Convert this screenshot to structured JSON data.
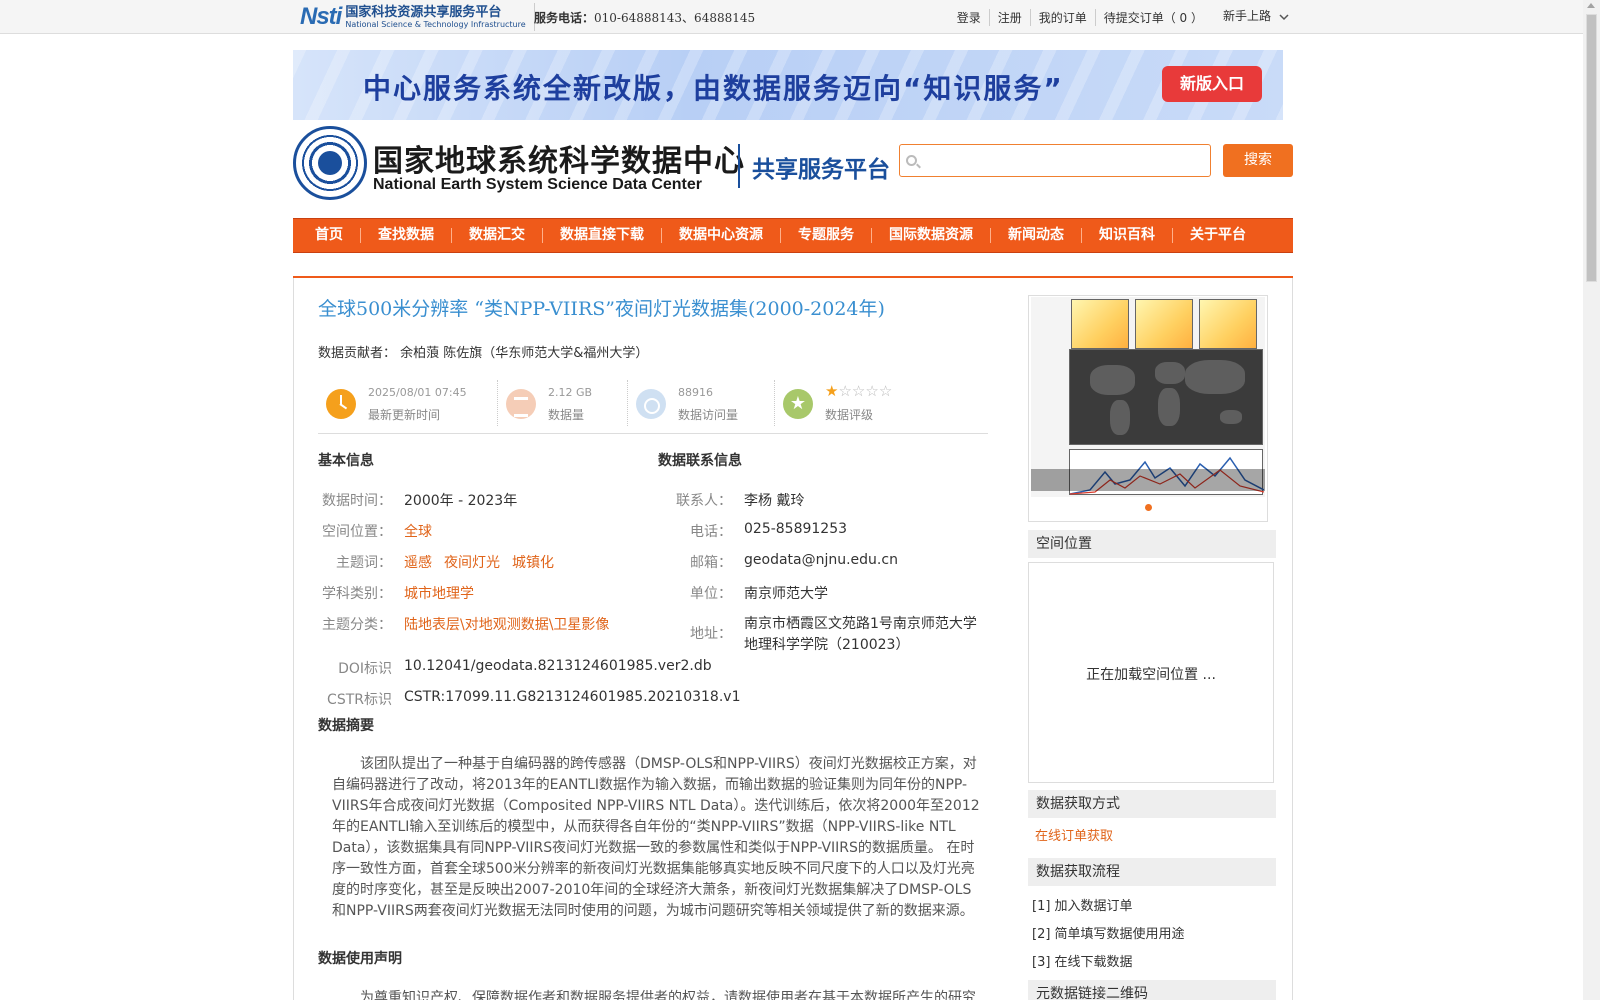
{
  "topbar": {
    "logo_mark": "Nsti",
    "logo_cn": "国家科技资源共享服务平台",
    "logo_en": "National Science & Technology Infrastructure",
    "phone_label": "服务电话：",
    "phone_value": "010-64888143、64888145",
    "links": [
      "登录",
      "注册",
      "我的订单",
      "待提交订单（ 0 ）"
    ],
    "newbie": "新手上路"
  },
  "banner": {
    "text": "中心服务系统全新改版，由数据服务迈向“知识服务”",
    "button": "新版入口"
  },
  "header": {
    "cn_name": "国家地球系统科学数据中心",
    "en_name": "National Earth System Science Data Center",
    "platform": "共享服务平台",
    "search_placeholder": "",
    "search_button": "搜索"
  },
  "nav": [
    "首页",
    "查找数据",
    "数据汇交",
    "数据直接下载",
    "数据中心资源",
    "专题服务",
    "国际数据资源",
    "新闻动态",
    "知识百科",
    "关于平台"
  ],
  "dataset": {
    "title": "全球500米分辨率 “类NPP-VIIRS”夜间灯光数据集(2000-2024年)",
    "contributor_label": "数据贡献者：",
    "contributor": "余柏蒗 陈佐旗（华东师范大学&福州大学）"
  },
  "stats": {
    "update_value": "2025/08/01 07:45",
    "update_label": "最新更新时间",
    "size_value": "2.12 GB",
    "size_label": "数据量",
    "visits_value": "88916",
    "visits_label": "数据访问量",
    "rating_label": "数据评级",
    "rating_stars": 1,
    "rating_max": 5
  },
  "basic": {
    "title": "基本信息",
    "time_label": "数据时间：",
    "time_value": "2000年 - 2023年",
    "space_label": "空间位置：",
    "space_value": "全球",
    "keywords_label": "主题词：",
    "keywords": [
      "遥感",
      "夜间灯光",
      "城镇化"
    ],
    "discipline_label": "学科类别：",
    "discipline_value": "城市地理学",
    "category_label": "主题分类：",
    "category_value": "陆地表层\\对地观测数据\\卫星影像",
    "doi_label": "DOI标识",
    "doi_value": "10.12041/geodata.8213124601985.ver2.db",
    "cstr_label": "CSTR标识",
    "cstr_value": "CSTR:17099.11.G8213124601985.20210318.v1"
  },
  "contact": {
    "title": "数据联系信息",
    "person_label": "联系人：",
    "person_value": "李杨 戴玲",
    "phone_label": "电话：",
    "phone_value": "025-85891253",
    "email_label": "邮箱：",
    "email_value": "geodata@njnu.edu.cn",
    "unit_label": "单位：",
    "unit_value": "南京师范大学",
    "address_label": "地址：",
    "address_line1": "南京市栖霞区文苑路1号南京师范大学",
    "address_line2": "地理科学学院（210023）"
  },
  "abstract": {
    "title": "数据摘要",
    "text": "该团队提出了一种基于自编码器的跨传感器（DMSP-OLS和NPP-VIIRS）夜间灯光数据校正方案，对自编码器进行了改动，将2013年的EANTLI数据作为输入数据，而输出数据的验证集则为同年份的NPP-VIIRS年合成夜间灯光数据（Composited NPP-VIIRS NTL Data）。迭代训练后，依次将2000年至2012年的EANTLI输入至训练后的模型中，从而获得各自年份的“类NPP-VIIRS”数据（NPP-VIIRS-like NTL Data），该数据集具有同NPP-VIIRS夜间灯光数据一致的参数属性和类似于NPP-VIIRS的数据质量。 在时序一致性方面，首套全球500米分辨率的新夜间灯光数据集能够真实地反映不同尺度下的人口以及灯光亮度的时序变化，甚至是反映出2007-2010年间的全球经济大萧条，新夜间灯光数据集解决了DMSP-OLS和NPP-VIIRS两套夜间灯光数据无法同时使用的问题，为城市问题研究等相关领域提供了新的数据来源。"
  },
  "usage": {
    "title": "数据使用声明",
    "text": "为尊重知识产权、保障数据作者和数据服务提供者的权益，请数据使用者在基于本数据所产生的研究"
  },
  "sidebar": {
    "space_title": "空间位置",
    "space_loading": "正在加载空间位置 ...",
    "access_title": "数据获取方式",
    "access_link": "在线订单获取",
    "process_title": "数据获取流程",
    "steps": [
      "[1] 加入数据订单",
      "[2] 简单填写数据使用用途",
      "[3] 在线下载数据"
    ],
    "qr_title": "元数据链接二维码"
  },
  "colors": {
    "accent_orange": "#ef5a1a",
    "title_blue": "#3a8fd0",
    "link_orange": "#e0641a",
    "brand_blue": "#1a4f9c"
  }
}
